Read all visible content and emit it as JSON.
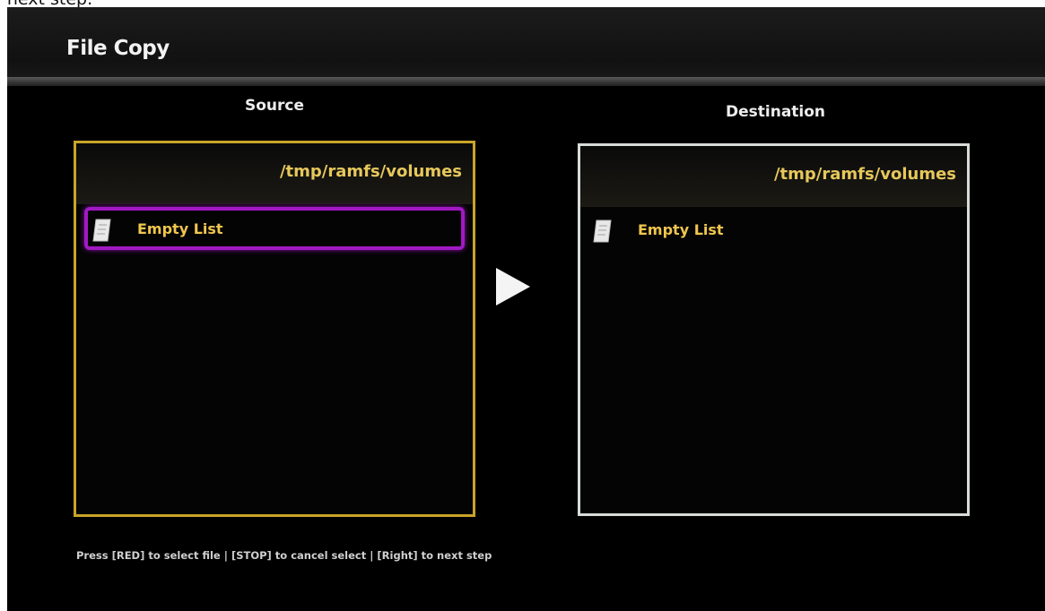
{
  "overlay_text": "r next step.",
  "window": {
    "title": "File Copy"
  },
  "source": {
    "header": "Source",
    "path": "/tmp/ramfs/volumes",
    "items": [
      {
        "label": "Empty List",
        "icon": "file-icon",
        "selected": true
      }
    ]
  },
  "destination": {
    "header": "Destination",
    "path": "/tmp/ramfs/volumes",
    "items": [
      {
        "label": "Empty List",
        "icon": "file-icon",
        "selected": false
      }
    ]
  },
  "hint": "Press [RED] to select file | [STOP] to cancel select | [Right] to next step",
  "colors": {
    "source_border": "#c9a42a",
    "destination_border": "#d8dcd8",
    "selection_border": "#a219c4",
    "item_text": "#f0c64e",
    "path_text": "#e6c75a"
  },
  "icons": {
    "arrow": "play-arrow-icon"
  }
}
